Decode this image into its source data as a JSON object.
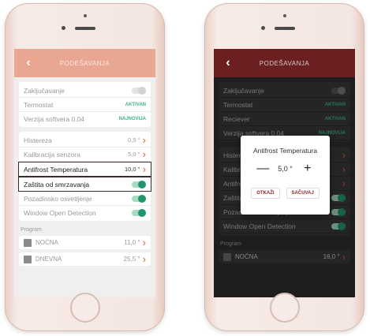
{
  "left": {
    "header_title": "PODEŠAVANJA",
    "back_glyph": "‹",
    "info_rows": [
      {
        "label": "Zaključavanje",
        "type": "toggle",
        "on": false
      },
      {
        "label": "Termostat",
        "type": "status",
        "value": "AKTIVAN"
      },
      {
        "label": "Verzija softvera 0.04",
        "type": "status",
        "value": "NAJNOVIJA"
      }
    ],
    "settings_rows": [
      {
        "label": "Histereza",
        "value": "0,5 °",
        "type": "chevron"
      },
      {
        "label": "Kalibracija senzora",
        "value": "5,0 °",
        "type": "chevron"
      },
      {
        "label": "Antifrost Temperatura",
        "value": "10,0 °",
        "type": "chevron"
      },
      {
        "label": "Zaštita od smrzavanja",
        "type": "toggle",
        "on": true
      },
      {
        "label": "Pozadinsko osvetljenje",
        "type": "toggle",
        "on": true
      },
      {
        "label": "Window Open Detection",
        "type": "toggle",
        "on": true
      }
    ],
    "program_label": "Program",
    "programs": [
      {
        "label": "NOĆNA",
        "value": "11,0 °"
      },
      {
        "label": "DNEVNA",
        "value": "25,5 °"
      }
    ]
  },
  "right": {
    "header_title": "PODEŠAVANJA",
    "back_glyph": "‹",
    "info_rows": [
      {
        "label": "Zaključavanje",
        "type": "toggle",
        "on": false
      },
      {
        "label": "Termostat",
        "type": "status",
        "value": "AKTIVAN"
      },
      {
        "label": "Reciever",
        "type": "status",
        "value": "AKTIVAN"
      },
      {
        "label": "Verzija softvera 0.04",
        "type": "status",
        "value": "NAJNOVIJA"
      }
    ],
    "settings_rows": [
      {
        "label": "Histereza",
        "value": "",
        "type": "chevron"
      },
      {
        "label": "Kalibracija senzora",
        "value": "",
        "type": "chevron"
      },
      {
        "label": "Antifrost Temperatura",
        "value": "",
        "type": "chevron"
      },
      {
        "label": "Zaštita od smrzavanja",
        "type": "toggle",
        "on": true
      },
      {
        "label": "Pozadinsko osvetljenje",
        "type": "toggle",
        "on": true
      },
      {
        "label": "Window Open Detection",
        "type": "toggle",
        "on": true
      }
    ],
    "program_label": "Program",
    "programs": [
      {
        "label": "NOĆNA",
        "value": "16,0 °"
      }
    ],
    "dialog": {
      "title": "Antifrost Temperatura",
      "minus": "—",
      "value": "5,0 °",
      "plus": "+",
      "cancel": "OTKAŽI",
      "save": "SAČUVAJ"
    }
  },
  "colors": {
    "header_light": "#e9a792",
    "header_dark": "#6b1f20",
    "accent": "#e05b3c",
    "toggle_on": "#23956a",
    "status_green": "#3cb38a"
  },
  "icons": {
    "back": "chevron-left-icon",
    "row_chevron": "chevron-right-icon",
    "program_square": "square-icon",
    "home_button": "home-button-icon"
  }
}
